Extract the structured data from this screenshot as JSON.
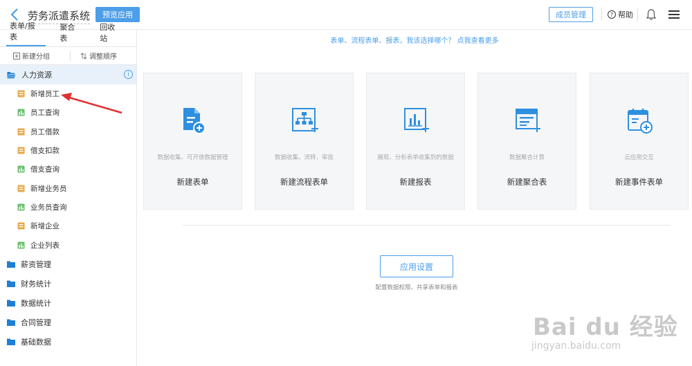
{
  "header": {
    "title": "劳务派遣系统",
    "preview_label": "预览应用",
    "member_label": "成员管理",
    "help_label": "帮助"
  },
  "sidebar": {
    "tabs": [
      {
        "label": "表单/报表",
        "active": true
      },
      {
        "label": "聚合表"
      },
      {
        "label": "回收站"
      }
    ],
    "toolbar": {
      "add_group": "新建分组",
      "reorder": "调整顺序"
    },
    "active_group": {
      "label": "人力资源",
      "items": [
        {
          "label": "新增员工",
          "type": "form"
        },
        {
          "label": "员工查询",
          "type": "report"
        },
        {
          "label": "员工借款",
          "type": "form"
        },
        {
          "label": "借支扣款",
          "type": "form"
        },
        {
          "label": "借支查询",
          "type": "report"
        },
        {
          "label": "新增业务员",
          "type": "form"
        },
        {
          "label": "业务员查询",
          "type": "report"
        },
        {
          "label": "新增企业",
          "type": "form"
        },
        {
          "label": "企业列表",
          "type": "report"
        }
      ]
    },
    "groups": [
      "薪资管理",
      "财务统计",
      "数据统计",
      "合同管理",
      "基础数据"
    ]
  },
  "main": {
    "hint": "表单、流程表单、报表，我该选择哪个？ 点我查看更多",
    "cards": [
      {
        "desc": "数据收集、可开放数据管理",
        "name": "新建表单",
        "icon": "form-add-icon"
      },
      {
        "desc": "数据收集、流转、审批",
        "name": "新建流程表单",
        "icon": "flow-form-icon"
      },
      {
        "desc": "展现、分析表单收集到的数据",
        "name": "新建报表",
        "icon": "report-chart-icon"
      },
      {
        "desc": "数据聚合计算",
        "name": "新建聚合表",
        "icon": "aggregate-table-icon"
      },
      {
        "desc": "云应用交互",
        "name": "新建事件表单",
        "icon": "event-form-icon"
      }
    ],
    "settings_label": "应用设置",
    "settings_desc": "配置数据权限、共享表单和报表"
  },
  "watermark": {
    "brand": "Bai du 经验",
    "url": "jingyan.baidu.com"
  },
  "colors": {
    "accent": "#4c9ee8",
    "form_icon": "#e8a94c",
    "report_icon": "#6cc071",
    "folder": "#1e7fd6"
  }
}
